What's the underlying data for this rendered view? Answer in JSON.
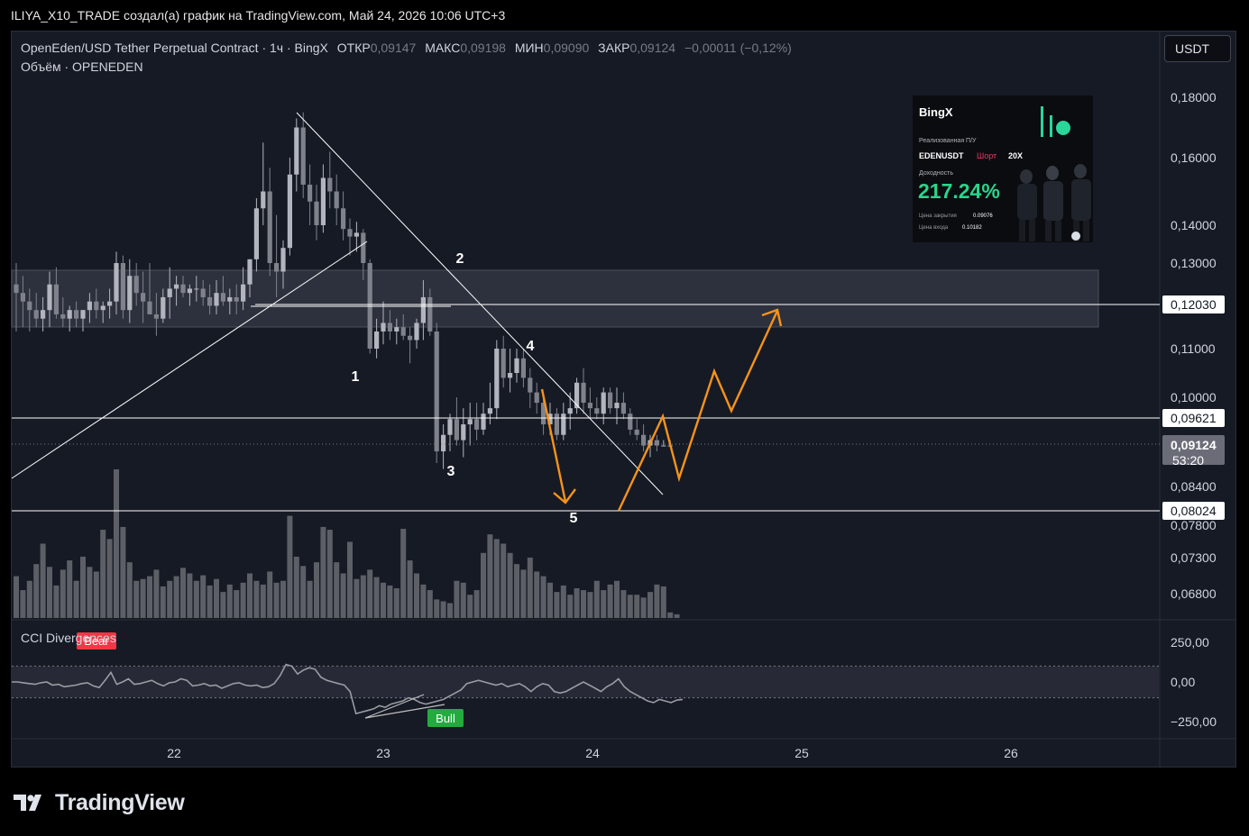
{
  "header": {
    "title": "ILIYA_X10_TRADE создал(а) график на TradingView.com, Май 24, 2026 10:06 UTC+3"
  },
  "legend": {
    "symbol": "OpenEden/USD Tether Perpetual Contract · 1ч · BingX",
    "open_label": "ОТКР",
    "open_value": "0,09147",
    "high_label": "МАКС",
    "high_value": "0,09198",
    "low_label": "МИН",
    "low_value": "0,09090",
    "close_label": "ЗАКР",
    "close_value": "0,09124",
    "change": "−0,00011 (−0,12%)",
    "volume": "Объём · OPENEDEN"
  },
  "currency_button": "USDT",
  "cci_legend": "CCI Divergences",
  "promo": {
    "brand": "BingX",
    "realized_label": "Реализованная П/У",
    "pair": "EDENUSDT",
    "side": "Шорт",
    "leverage": "20X",
    "yield_label": "Доходность",
    "yield_value": "217.24%",
    "close_price_label": "Цена закрытия",
    "close_price_value": "0.09076",
    "entry_price_label": "Цена входа",
    "entry_price_value": "0.10182"
  },
  "colors": {
    "background": "#161a25",
    "candle": "#8c8c8c",
    "arrow": "#f7931a",
    "bear": "#f23645",
    "bull": "#22ab3e"
  },
  "chart_data": [
    {
      "type": "candlestick",
      "title": "",
      "ylabel": "",
      "xlabel": "",
      "x_ticks": [
        "22",
        "23",
        "24",
        "25",
        "26"
      ],
      "y_ticks": [
        "0,18000",
        "0,16000",
        "0,14000",
        "0,13000",
        "0,11000",
        "0,10000",
        "0,08400",
        "0,07800",
        "0,07300",
        "0,06800"
      ],
      "ylim": [
        0.066,
        0.19
      ],
      "price_labels": [
        "0,12030",
        "0,09621",
        "0,08024"
      ],
      "current_price": "0,09124",
      "countdown": "53:20",
      "horizontal_levels": [
        0.1203,
        0.09621,
        0.08024,
        0.09124
      ],
      "zone": [
        0.1155,
        0.1283
      ],
      "wave_labels": [
        "1",
        "2",
        "3",
        "4",
        "5"
      ],
      "ohlc": [
        [
          0.125,
          0.13,
          0.114,
          0.123
        ],
        [
          0.123,
          0.127,
          0.115,
          0.121
        ],
        [
          0.121,
          0.124,
          0.114,
          0.119
        ],
        [
          0.119,
          0.123,
          0.115,
          0.117
        ],
        [
          0.117,
          0.122,
          0.114,
          0.119
        ],
        [
          0.119,
          0.128,
          0.115,
          0.125
        ],
        [
          0.125,
          0.129,
          0.117,
          0.118
        ],
        [
          0.118,
          0.122,
          0.115,
          0.117
        ],
        [
          0.117,
          0.12,
          0.114,
          0.119
        ],
        [
          0.119,
          0.121,
          0.115,
          0.117
        ],
        [
          0.117,
          0.119,
          0.114,
          0.119
        ],
        [
          0.119,
          0.123,
          0.116,
          0.121
        ],
        [
          0.121,
          0.124,
          0.117,
          0.119
        ],
        [
          0.119,
          0.121,
          0.116,
          0.12
        ],
        [
          0.12,
          0.124,
          0.117,
          0.121
        ],
        [
          0.121,
          0.133,
          0.118,
          0.13
        ],
        [
          0.13,
          0.132,
          0.117,
          0.119
        ],
        [
          0.119,
          0.131,
          0.116,
          0.127
        ],
        [
          0.127,
          0.13,
          0.12,
          0.123
        ],
        [
          0.123,
          0.128,
          0.116,
          0.121
        ],
        [
          0.121,
          0.13,
          0.118,
          0.118
        ],
        [
          0.118,
          0.123,
          0.113,
          0.117
        ],
        [
          0.117,
          0.124,
          0.116,
          0.122
        ],
        [
          0.122,
          0.129,
          0.117,
          0.124
        ],
        [
          0.124,
          0.127,
          0.12,
          0.125
        ],
        [
          0.125,
          0.127,
          0.122,
          0.123
        ],
        [
          0.123,
          0.125,
          0.12,
          0.124
        ],
        [
          0.124,
          0.127,
          0.121,
          0.124
        ],
        [
          0.124,
          0.126,
          0.12,
          0.122
        ],
        [
          0.122,
          0.125,
          0.118,
          0.12
        ],
        [
          0.12,
          0.126,
          0.118,
          0.123
        ],
        [
          0.123,
          0.127,
          0.12,
          0.121
        ],
        [
          0.121,
          0.124,
          0.118,
          0.122
        ],
        [
          0.122,
          0.125,
          0.118,
          0.121
        ],
        [
          0.121,
          0.129,
          0.119,
          0.125
        ],
        [
          0.125,
          0.131,
          0.122,
          0.131
        ],
        [
          0.131,
          0.148,
          0.128,
          0.145
        ],
        [
          0.145,
          0.165,
          0.14,
          0.15
        ],
        [
          0.15,
          0.157,
          0.127,
          0.13
        ],
        [
          0.13,
          0.143,
          0.122,
          0.128
        ],
        [
          0.128,
          0.136,
          0.124,
          0.134
        ],
        [
          0.134,
          0.16,
          0.132,
          0.155
        ],
        [
          0.155,
          0.173,
          0.15,
          0.17
        ],
        [
          0.17,
          0.175,
          0.148,
          0.152
        ],
        [
          0.152,
          0.158,
          0.14,
          0.147
        ],
        [
          0.147,
          0.152,
          0.136,
          0.14
        ],
        [
          0.14,
          0.158,
          0.138,
          0.154
        ],
        [
          0.154,
          0.162,
          0.145,
          0.15
        ],
        [
          0.15,
          0.155,
          0.14,
          0.145
        ],
        [
          0.145,
          0.15,
          0.136,
          0.139
        ],
        [
          0.139,
          0.142,
          0.132,
          0.137
        ],
        [
          0.137,
          0.141,
          0.133,
          0.138
        ],
        [
          0.138,
          0.139,
          0.126,
          0.13
        ],
        [
          0.13,
          0.131,
          0.109,
          0.11
        ],
        [
          0.11,
          0.117,
          0.108,
          0.114
        ],
        [
          0.114,
          0.121,
          0.111,
          0.116
        ],
        [
          0.116,
          0.119,
          0.112,
          0.114
        ],
        [
          0.114,
          0.117,
          0.111,
          0.115
        ],
        [
          0.115,
          0.118,
          0.112,
          0.113
        ],
        [
          0.113,
          0.115,
          0.107,
          0.112
        ],
        [
          0.112,
          0.117,
          0.11,
          0.116
        ],
        [
          0.116,
          0.126,
          0.112,
          0.122
        ],
        [
          0.122,
          0.124,
          0.113,
          0.114
        ],
        [
          0.114,
          0.116,
          0.088,
          0.09
        ],
        [
          0.09,
          0.095,
          0.087,
          0.093
        ],
        [
          0.093,
          0.097,
          0.09,
          0.096
        ],
        [
          0.096,
          0.1,
          0.091,
          0.092
        ],
        [
          0.092,
          0.098,
          0.089,
          0.095
        ],
        [
          0.095,
          0.099,
          0.091,
          0.096
        ],
        [
          0.096,
          0.099,
          0.092,
          0.094
        ],
        [
          0.094,
          0.099,
          0.093,
          0.097
        ],
        [
          0.097,
          0.103,
          0.095,
          0.098
        ],
        [
          0.098,
          0.112,
          0.096,
          0.11
        ],
        [
          0.11,
          0.113,
          0.102,
          0.104
        ],
        [
          0.104,
          0.11,
          0.101,
          0.105
        ],
        [
          0.105,
          0.11,
          0.103,
          0.108
        ],
        [
          0.108,
          0.11,
          0.102,
          0.104
        ],
        [
          0.104,
          0.106,
          0.098,
          0.101
        ],
        [
          0.101,
          0.103,
          0.097,
          0.099
        ],
        [
          0.099,
          0.1,
          0.093,
          0.095
        ],
        [
          0.095,
          0.099,
          0.093,
          0.097
        ],
        [
          0.097,
          0.098,
          0.092,
          0.093
        ],
        [
          0.093,
          0.099,
          0.092,
          0.097
        ],
        [
          0.097,
          0.101,
          0.094,
          0.098
        ],
        [
          0.098,
          0.104,
          0.097,
          0.103
        ],
        [
          0.103,
          0.106,
          0.097,
          0.099
        ],
        [
          0.099,
          0.102,
          0.096,
          0.098
        ],
        [
          0.098,
          0.1,
          0.096,
          0.097
        ],
        [
          0.097,
          0.102,
          0.095,
          0.101
        ],
        [
          0.101,
          0.102,
          0.097,
          0.098
        ],
        [
          0.098,
          0.102,
          0.095,
          0.099
        ],
        [
          0.099,
          0.101,
          0.096,
          0.097
        ],
        [
          0.097,
          0.098,
          0.093,
          0.094
        ],
        [
          0.094,
          0.096,
          0.092,
          0.093
        ],
        [
          0.093,
          0.095,
          0.09,
          0.091
        ],
        [
          0.091,
          0.093,
          0.089,
          0.092
        ],
        [
          0.092,
          0.093,
          0.09,
          0.091
        ],
        [
          0.091,
          0.092,
          0.091,
          0.091
        ],
        [
          0.091,
          0.092,
          0.091,
          0.091
        ]
      ],
      "volume": [
        45,
        30,
        40,
        58,
        80,
        55,
        35,
        52,
        62,
        40,
        66,
        55,
        50,
        95,
        85,
        160,
        98,
        60,
        40,
        42,
        45,
        52,
        34,
        40,
        45,
        54,
        48,
        40,
        46,
        35,
        42,
        28,
        36,
        30,
        38,
        48,
        40,
        36,
        50,
        38,
        40,
        110,
        66,
        56,
        40,
        60,
        98,
        95,
        60,
        48,
        82,
        42,
        46,
        52,
        44,
        38,
        35,
        32,
        96,
        62,
        48,
        36,
        30,
        20,
        18,
        16,
        40,
        38,
        25,
        30,
        70,
        90,
        85,
        80,
        70,
        58,
        52,
        65,
        50,
        45,
        38,
        28,
        35,
        25,
        32,
        30,
        28,
        40,
        30,
        36,
        40,
        30,
        25,
        25,
        22,
        28,
        36,
        34,
        6,
        4
      ],
      "cci": [
        0,
        0,
        -5,
        -10,
        -15,
        -5,
        0,
        -20,
        -15,
        -30,
        -25,
        -20,
        -10,
        -5,
        -25,
        -35,
        10,
        60,
        -15,
        0,
        20,
        -15,
        -10,
        0,
        10,
        -10,
        -25,
        -5,
        0,
        20,
        10,
        -25,
        -20,
        -10,
        -25,
        -20,
        -40,
        -25,
        -10,
        -5,
        -20,
        -25,
        -20,
        -35,
        -30,
        -10,
        40,
        110,
        100,
        50,
        75,
        90,
        80,
        30,
        10,
        0,
        -10,
        -20,
        -60,
        -200,
        -190,
        -180,
        -170,
        -150,
        -160,
        -140,
        -130,
        -120,
        -100,
        -110,
        -130,
        -140,
        -130,
        -120,
        -110,
        -90,
        -70,
        -50,
        -10,
        0,
        10,
        0,
        -10,
        -20,
        -10,
        -30,
        -20,
        -10,
        -30,
        -60,
        -30,
        -10,
        -20,
        -60,
        -70,
        -60,
        -40,
        -20,
        0,
        -20,
        -40,
        -60,
        -30,
        -10,
        20,
        -30,
        -60,
        -80,
        -100,
        -120,
        -130,
        -110,
        -120,
        -130,
        -115,
        -110
      ],
      "cci_ticks": [
        "250,00",
        "0,00",
        "−250,00"
      ],
      "cci_band": [
        -100,
        100
      ],
      "cci_markers": [
        "Bear",
        "Bull"
      ]
    }
  ]
}
